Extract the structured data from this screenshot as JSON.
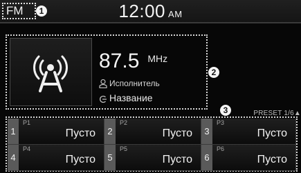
{
  "status_bar": {
    "mode": "FM",
    "time": "12:00",
    "ampm": "AM"
  },
  "callouts": [
    "1",
    "2",
    "3"
  ],
  "now_playing": {
    "frequency": "87.5",
    "unit": "MHz",
    "artist": "Исполнитель",
    "title": "Название",
    "artwork_icon": "radio-broadcast-icon"
  },
  "presets": {
    "page_label": "PRESET 1/6",
    "items": [
      {
        "number": "1",
        "tag": "P1",
        "name": "Пусто"
      },
      {
        "number": "2",
        "tag": "P2",
        "name": "Пусто"
      },
      {
        "number": "3",
        "tag": "P3",
        "name": "Пусто"
      },
      {
        "number": "4",
        "tag": "P4",
        "name": "Пусто"
      },
      {
        "number": "5",
        "tag": "P5",
        "name": "Пусто"
      },
      {
        "number": "6",
        "tag": "P6",
        "name": "Пусто"
      }
    ]
  }
}
